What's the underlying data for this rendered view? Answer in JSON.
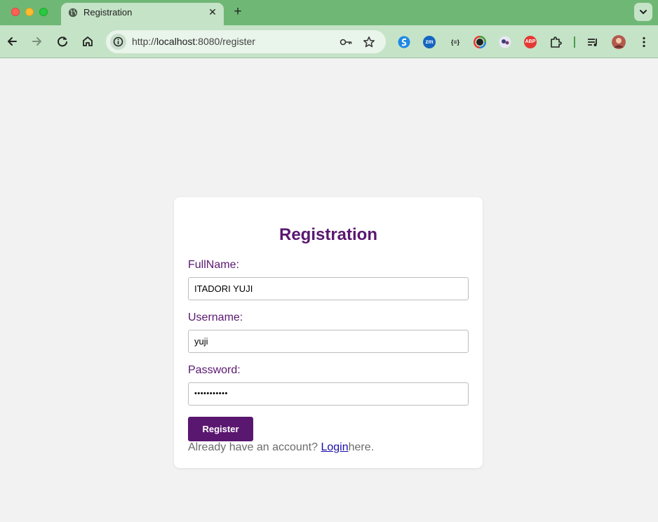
{
  "browser": {
    "tab_title": "Registration",
    "tab_close": "✕",
    "new_tab": "+",
    "url_scheme": "http://",
    "url_host": "localhost",
    "url_rest": ":8080/register"
  },
  "extensions": [
    {
      "name": "blue-s-extension-icon",
      "text": ""
    },
    {
      "name": "zm-extension-icon",
      "text": "zm"
    },
    {
      "name": "json-extension-icon",
      "text": "{≡}"
    },
    {
      "name": "color-picker-extension-icon",
      "text": ""
    },
    {
      "name": "profile-extension-icon",
      "text": ""
    },
    {
      "name": "adblock-extension-icon",
      "text": "ABP"
    }
  ],
  "form": {
    "title": "Registration",
    "fullname_label": "FullName:",
    "fullname_value": "ITADORI YUJI",
    "username_label": "Username:",
    "username_value": "yuji",
    "password_label": "Password:",
    "password_value": "•••••••••••",
    "register_label": "Register",
    "footer_prefix": "Already have an account? ",
    "login_link": "Login",
    "footer_suffix": "here."
  },
  "colors": {
    "accent": "#5a1770",
    "frame": "#6fb775",
    "toolbar": "#c5e3c7"
  }
}
